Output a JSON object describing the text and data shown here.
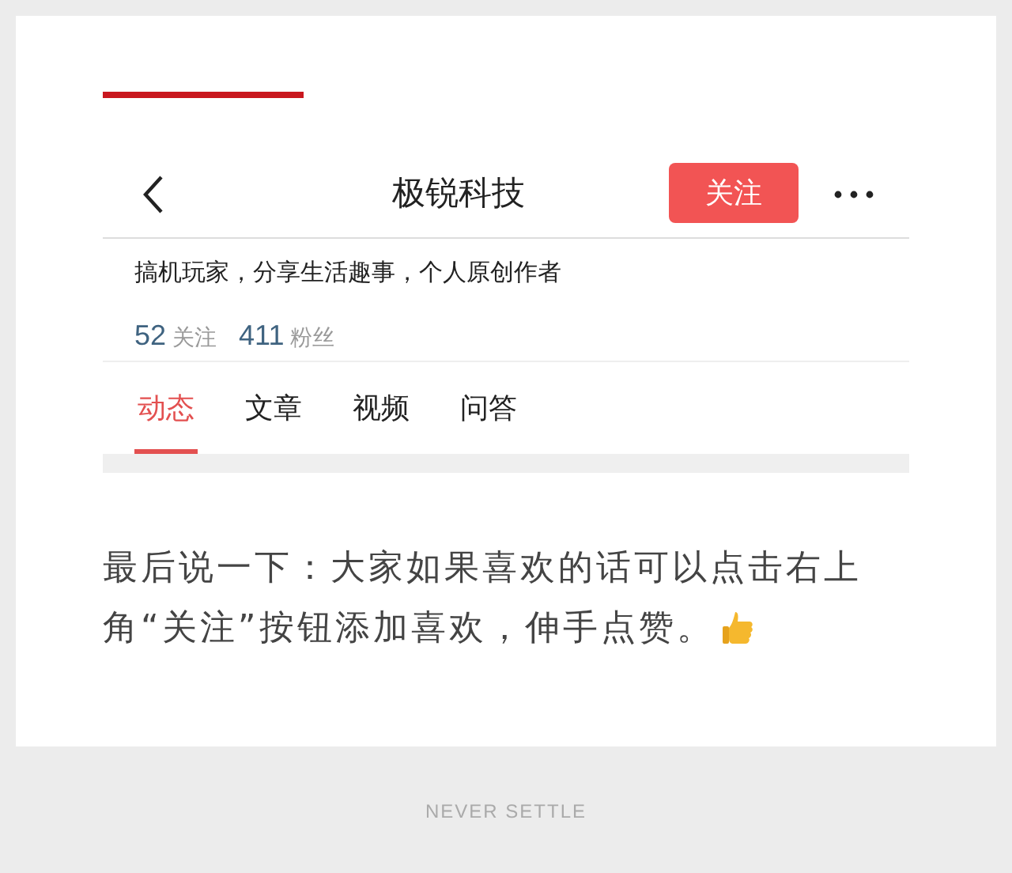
{
  "profile_screenshot": {
    "title": "极锐科技",
    "follow_button": "关注",
    "bio": "搞机玩家，分享生活趣事，个人原创作者",
    "stats": [
      {
        "count": "52",
        "label": "关注"
      },
      {
        "count": "411",
        "label": "粉丝"
      }
    ],
    "tabs": [
      {
        "label": "动态",
        "selected": true
      },
      {
        "label": "文章",
        "selected": false
      },
      {
        "label": "视频",
        "selected": false
      },
      {
        "label": "问答",
        "selected": false
      }
    ]
  },
  "paragraph_lines": [
    "最后说一下：大家如果喜欢的话可以点击右上",
    "角“关注”按钮添加喜欢，伸手点赞。"
  ],
  "footer": "NEVER SETTLE"
}
